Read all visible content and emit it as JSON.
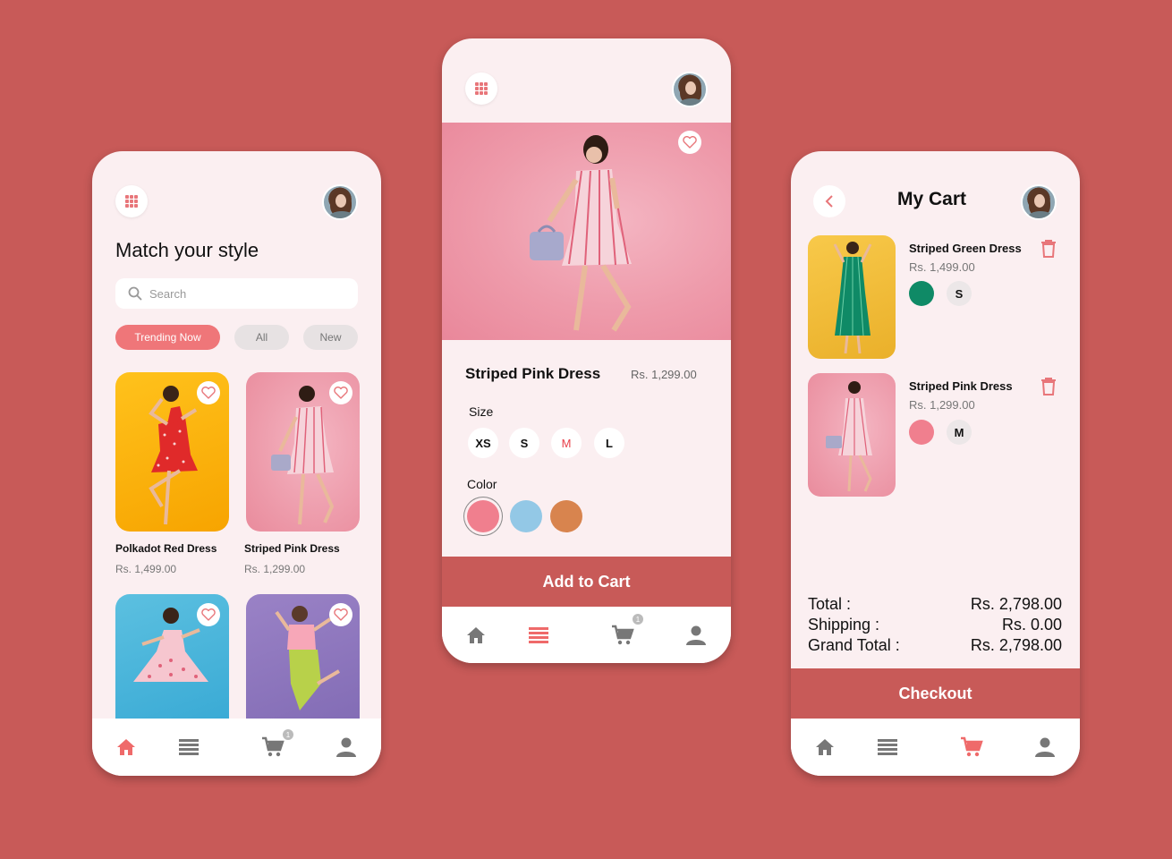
{
  "colors": {
    "background": "#c85a58",
    "accent": "#ef7679",
    "brand_dark": "#c85a58"
  },
  "screen1": {
    "title": "Match your style",
    "search_placeholder": "Search",
    "chips": [
      "Trending Now",
      "All",
      "New"
    ],
    "products": [
      {
        "name": "Polkadot Red Dress",
        "price": "Rs.  1,499.00"
      },
      {
        "name": "Striped Pink Dress",
        "price": "Rs.  1,299.00"
      }
    ],
    "cart_badge": "1"
  },
  "screen2": {
    "product_name": "Striped Pink Dress",
    "price": "Rs.  1,299.00",
    "size_label": "Size",
    "sizes": [
      "XS",
      "S",
      "M",
      "L"
    ],
    "selected_size": "M",
    "color_label": "Color",
    "colors": [
      "#f07f8e",
      "#93c8e6",
      "#d8844e"
    ],
    "add_to_cart": "Add to Cart",
    "cart_badge": "1"
  },
  "screen3": {
    "title": "My Cart",
    "items": [
      {
        "name": "Striped Green Dress",
        "price": "Rs.  1,499.00",
        "color": "#0f8a66",
        "size": "S"
      },
      {
        "name": "Striped Pink Dress",
        "price": "Rs.  1,299.00",
        "color": "#f07f8e",
        "size": "M"
      }
    ],
    "summary": {
      "total_label": "Total :",
      "total_value": "Rs. 2,798.00",
      "shipping_label": "Shipping :",
      "shipping_value": "Rs. 0.00",
      "grand_label": "Grand Total :",
      "grand_value": "Rs. 2,798.00"
    },
    "checkout": "Checkout"
  },
  "icons": [
    "grid-menu-icon",
    "avatar",
    "search-icon",
    "heart-icon",
    "home-icon",
    "list-icon",
    "cart-icon",
    "user-icon",
    "back-chevron-icon",
    "trash-icon"
  ]
}
